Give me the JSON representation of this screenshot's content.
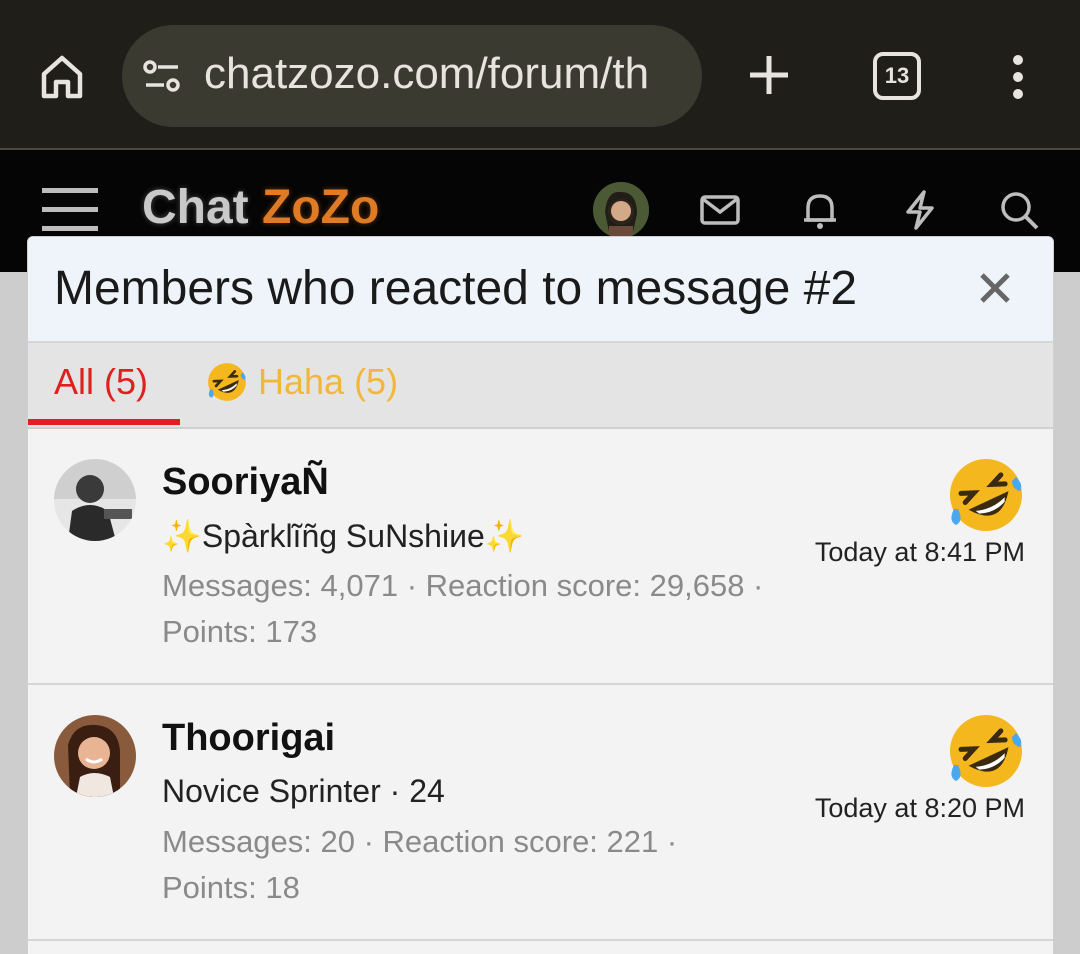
{
  "browser": {
    "url": "chatzozo.com/forum/th",
    "tab_count": "13",
    "icons": [
      "home-icon",
      "site-info-icon",
      "new-tab-icon",
      "more-vert-icon"
    ]
  },
  "site": {
    "logo_part1": "Chat",
    "logo_part2": "ZoZo",
    "icons": [
      "menu-icon",
      "mail-icon",
      "bell-icon",
      "bolt-icon",
      "search-icon"
    ]
  },
  "modal": {
    "title": "Members who reacted to message #2",
    "tabs": [
      {
        "label": "All (5)",
        "active": true
      },
      {
        "label": "Haha (5)",
        "active": false
      }
    ],
    "members": [
      {
        "name": "SooriyaÑ",
        "title_left": "✨",
        "title_text": "Spàrklĩñg SuNshiиe",
        "title_right": "✨",
        "stats_line": "Messages: 4,071 · Reaction score: 29,658 ·",
        "stats_line2": "Points: 173",
        "reaction": "haha-emoji",
        "time": "Today at 8:41 PM"
      },
      {
        "name": "Thoorigai",
        "title_left": "",
        "title_text": "Novice Sprinter · 24",
        "title_right": "",
        "stats_line": "Messages: 20 · Reaction score: 221 ·",
        "stats_line2": "Points: 18",
        "reaction": "haha-emoji",
        "time": "Today at 8:20 PM"
      }
    ]
  },
  "colors": {
    "active_tab": "#e01f1f",
    "haha_tab": "#f2b73a",
    "browser_bg": "#1f1e18",
    "header_bg": "#050505",
    "logo_accent": "#e07b25"
  }
}
